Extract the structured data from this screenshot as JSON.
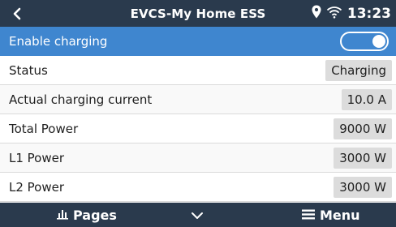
{
  "topbar": {
    "title": "EVCS-My Home ESS",
    "clock": "13:23",
    "icons": [
      "back-chevron-icon",
      "location-pin-icon",
      "wifi-icon"
    ]
  },
  "list": {
    "rows": [
      {
        "label": "Enable charging",
        "type": "switch",
        "switch_on": true
      },
      {
        "label": "Status",
        "value": "Charging"
      },
      {
        "label": "Actual charging current",
        "value": "10.0 A"
      },
      {
        "label": "Total Power",
        "value": "9000 W"
      },
      {
        "label": "L1 Power",
        "value": "3000 W"
      },
      {
        "label": "L2 Power",
        "value": "3000 W"
      }
    ]
  },
  "bottombar": {
    "pages_label": "Pages",
    "menu_label": "Menu",
    "icons": [
      "bar-chart-icon",
      "chevron-down-icon",
      "hamburger-icon"
    ]
  },
  "colors": {
    "header": "#2a3a4d",
    "selected_row": "#3f86cf",
    "value_box": "#dcdcdc"
  }
}
